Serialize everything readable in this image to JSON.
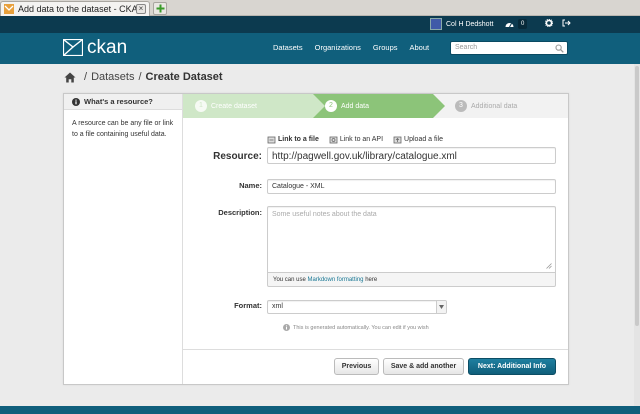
{
  "browser": {
    "tab_title": "Add data to the dataset - CKAN",
    "close_glyph": "×",
    "new_tab_glyph": "+"
  },
  "account": {
    "user_name": "Col H Dedshott",
    "dashboard_count": "0"
  },
  "masthead": {
    "logo_text": "ckan",
    "nav": [
      "Datasets",
      "Organizations",
      "Groups",
      "About"
    ],
    "search_placeholder": "Search"
  },
  "breadcrumb": {
    "separator": "/",
    "items": [
      "Datasets",
      "Create Dataset"
    ]
  },
  "aside": {
    "heading": "What's a resource?",
    "body": "A resource can be any file or link to a file containing useful data."
  },
  "stages": [
    {
      "number": "1",
      "label": "Create dataset"
    },
    {
      "number": "2",
      "label": "Add data"
    },
    {
      "number": "3",
      "label": "Additional data"
    }
  ],
  "form": {
    "resource_links": [
      "Link to a file",
      "Link to an API",
      "Upload a file"
    ],
    "resource_label": "Resource:",
    "resource_value": "http://pagwell.gov.uk/library/catalogue.xml",
    "name_label": "Name:",
    "name_value": "Catalogue - XML",
    "description_label": "Description:",
    "description_placeholder": "Some useful notes about the data",
    "description_note_prefix": "You can use",
    "description_note_link": "Markdown formatting",
    "description_note_suffix": "here",
    "format_label": "Format:",
    "format_value": "xml",
    "format_help": "This is generated automatically. You can edit if you wish"
  },
  "actions": {
    "previous": "Previous",
    "save_add": "Save & add another",
    "next": "Next: Additional Info"
  },
  "colors": {
    "masthead": "#105f7c",
    "account_bar": "#0c3a4f",
    "stage_active": "#8cc479",
    "stage_done": "#cfe7c7",
    "primary_button": "#105e7a"
  }
}
